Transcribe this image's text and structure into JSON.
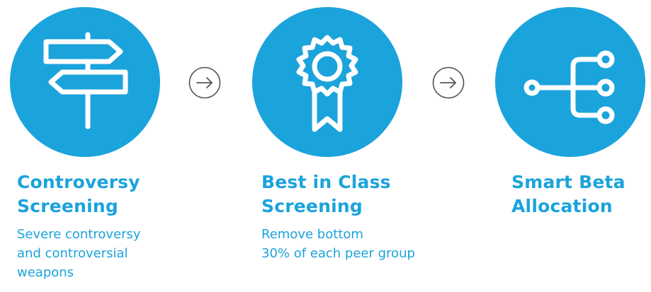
{
  "colors": {
    "accent": "#1ba3dc",
    "icon": "#ffffff"
  },
  "steps": [
    {
      "icon": "signpost-icon",
      "title_lines": [
        "Controversy",
        "Screening"
      ],
      "desc_lines": [
        "Severe controversy",
        "and controversial",
        "weapons"
      ]
    },
    {
      "icon": "award-ribbon-icon",
      "title_lines": [
        "Best in Class",
        "Screening"
      ],
      "desc_lines": [
        "Remove bottom",
        "30% of each peer group"
      ]
    },
    {
      "icon": "branching-network-icon",
      "title_lines": [
        "Smart Beta",
        "Allocation"
      ],
      "desc_lines": []
    }
  ],
  "arrows": [
    "arrow-right-icon",
    "arrow-right-icon"
  ]
}
